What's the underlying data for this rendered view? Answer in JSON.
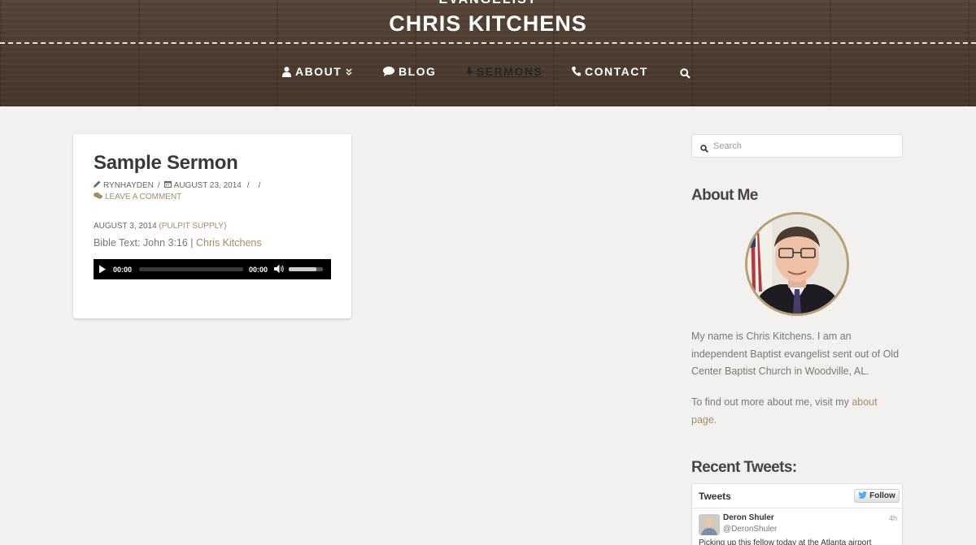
{
  "header": {
    "tagline": "EVANGELIST",
    "site_title": "CHRIS KITCHENS"
  },
  "nav": {
    "items": [
      {
        "label": "ABOUT",
        "icon": "user-icon",
        "has_dropdown": true
      },
      {
        "label": "BLOG",
        "icon": "comment-icon"
      },
      {
        "label": "SERMONS",
        "icon": "microphone-icon",
        "active": true
      },
      {
        "label": "CONTACT",
        "icon": "phone-icon"
      }
    ],
    "search_icon": "search-icon"
  },
  "post": {
    "title": "Sample Sermon",
    "author": "RYNHAYDEN",
    "date": "AUGUST 23, 2014",
    "separator_1": "/",
    "separator_2": "/",
    "separator_3": "/",
    "comment_link": "LEAVE A COMMENT",
    "sermon_date": "AUGUST 3, 2014",
    "sermon_category": "(PULPIT SUPPLY)",
    "bible_text": "Bible Text: John 3:16 |",
    "preacher": "Chris Kitchens",
    "player": {
      "current_time": "00:00",
      "duration": "00:00",
      "volume_level": 0.8
    }
  },
  "sidebar": {
    "search_placeholder": "Search",
    "about_title": "About Me",
    "about_text": "My name is Chris Kitchens. I am an independent Baptist evangelist sent out of Old Center Baptist Church in Woodville, AL.",
    "about_more_prefix": "To find out more about me, visit my",
    "about_more_link": "about page.",
    "tweets_title": "Recent Tweets:",
    "twitter": {
      "header": "Tweets",
      "follow_label": "Follow",
      "tweet": {
        "name": "Deron Shuler",
        "handle": "@DeronShuler",
        "time": "4h",
        "text": "Picking up this fellow today at the Atlanta airport"
      }
    }
  },
  "colors": {
    "header_bg": "#4d3b2e",
    "accent": "#a28d6a",
    "page_bg": "#f2f1f0"
  }
}
